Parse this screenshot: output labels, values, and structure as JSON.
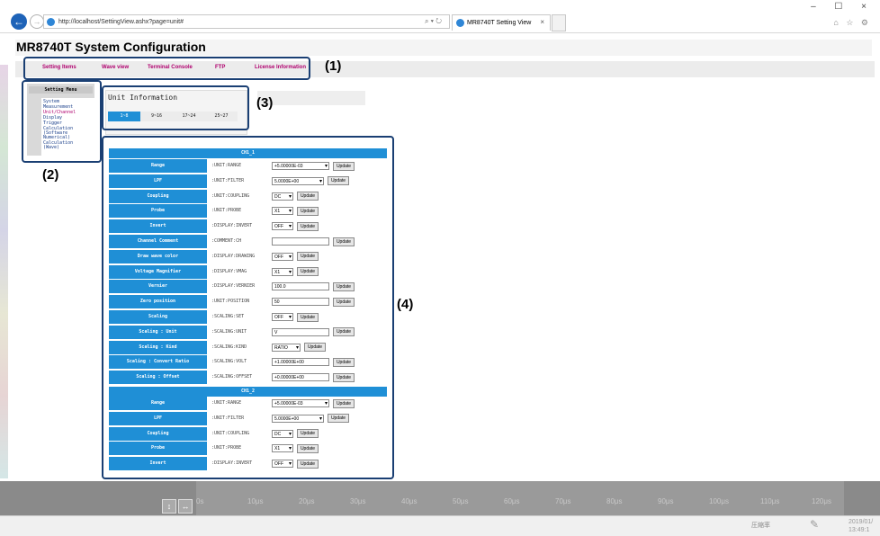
{
  "browser": {
    "url": "http://localhost/SettingView.ashx?page=unit#",
    "address_tools": "⌕ ▾ ↻",
    "tab_title": "MR8740T Setting View",
    "tab_close": "×",
    "window_controls": "– ☐ ×",
    "tool_icons": "⌂ ☆ ⚙"
  },
  "page": {
    "title": "MR8740T System Configuration",
    "menu": [
      "Setting Items",
      "Wave view",
      "Terminal Console",
      "FTP",
      "License Information"
    ],
    "accent_color": "#1f8fd6",
    "active_menu_color": "#b0006e"
  },
  "callouts": [
    "(1)",
    "(2)",
    "(3)",
    "(4)"
  ],
  "side_menu": {
    "header": "Setting Menu",
    "items": [
      "System",
      "Measurement",
      "Unit/Channel",
      "Display",
      "Trigger",
      "Calculation",
      "(Software",
      "Numerical)",
      "Calculation",
      "(Wave)"
    ]
  },
  "unit_info": {
    "title": "Unit Information",
    "tabs": [
      "1~8",
      "9~16",
      "17~24",
      "25~27"
    ]
  },
  "table": {
    "ch1_header": "CH1_1",
    "ch2_header": "CH1_2",
    "update": "Update",
    "ch1_rows": [
      {
        "label": "Range",
        "cmd": ":UNIT:RANGE",
        "value": "+5.00000E-03"
      },
      {
        "label": "LPF",
        "cmd": ":UNIT:FILTER",
        "value": "5.0000E+00"
      },
      {
        "label": "Coupling",
        "cmd": ":UNIT:COUPLING",
        "value": "DC"
      },
      {
        "label": "Probe",
        "cmd": ":UNIT:PROBE",
        "value": "X1"
      },
      {
        "label": "Invert",
        "cmd": ":DISPLAY:INVERT",
        "value": "OFF"
      },
      {
        "label": "Channel Comment",
        "cmd": ":COMMENT:CH",
        "value": ""
      },
      {
        "label": "Draw wave color",
        "cmd": ":DISPLAY:DRAWING",
        "value": "OFF"
      },
      {
        "label": "Voltage Magnifier",
        "cmd": ":DISPLAY:VMAG",
        "value": "X1"
      },
      {
        "label": "Vernier",
        "cmd": ":DISPLAY:VERNIER",
        "value": "100.0"
      },
      {
        "label": "Zero position",
        "cmd": ":UNIT:POSITION",
        "value": "50"
      },
      {
        "label": "Scaling",
        "cmd": ":SCALING:SET",
        "value": "OFF"
      },
      {
        "label": "Scaling : Unit",
        "cmd": ":SCALING:UNIT",
        "value": "V"
      },
      {
        "label": "Scaling : Kind",
        "cmd": ":SCALING:KIND",
        "value": "RATIO"
      },
      {
        "label": "Scaling : Convert Ratio",
        "cmd": ":SCALING:VOLT",
        "value": "+1.00000E+00"
      },
      {
        "label": "Scaling : Offset",
        "cmd": ":SCALING:OFFSET",
        "value": "+0.00000E+00"
      }
    ],
    "ch2_rows": [
      {
        "label": "Range",
        "cmd": ":UNIT:RANGE",
        "value": "+5.00000E-03"
      },
      {
        "label": "LPF",
        "cmd": ":UNIT:FILTER",
        "value": "5.0000E+00"
      },
      {
        "label": "Coupling",
        "cmd": ":UNIT:COUPLING",
        "value": "DC"
      },
      {
        "label": "Probe",
        "cmd": ":UNIT:PROBE",
        "value": "X1"
      },
      {
        "label": "Invert",
        "cmd": ":DISPLAY:INVERT",
        "value": "OFF"
      }
    ]
  },
  "timeline": {
    "ticks": [
      "0s",
      "10μs",
      "20μs",
      "30μs",
      "40μs",
      "50μs",
      "60μs",
      "70μs",
      "80μs",
      "90μs",
      "100μs",
      "110μs",
      "120μs"
    ],
    "zoom_label": "圧縮率",
    "date": "2019/01/",
    "time": "13:49:1"
  }
}
